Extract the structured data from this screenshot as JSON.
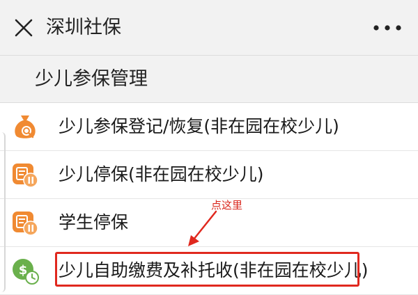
{
  "header": {
    "app_title": "深圳社保"
  },
  "section": {
    "title": "少儿参保管理"
  },
  "items": [
    {
      "label": "少儿参保登记/恢复(非在园在校少儿)",
      "icon": "money-bag-icon"
    },
    {
      "label": "少儿停保(非在园在校少儿)",
      "icon": "pause-card-icon"
    },
    {
      "label": "学生停保",
      "icon": "pause-card-icon"
    },
    {
      "label": "少儿自助缴费及补托收(非在园在校少儿)",
      "icon": "payment-clock-icon"
    }
  ],
  "annotation": {
    "text": "点这里",
    "color": "#e0281e"
  },
  "colors": {
    "accent_orange": "#f08a32",
    "accent_green": "#6ab04c",
    "background": "#f2f2f2"
  }
}
